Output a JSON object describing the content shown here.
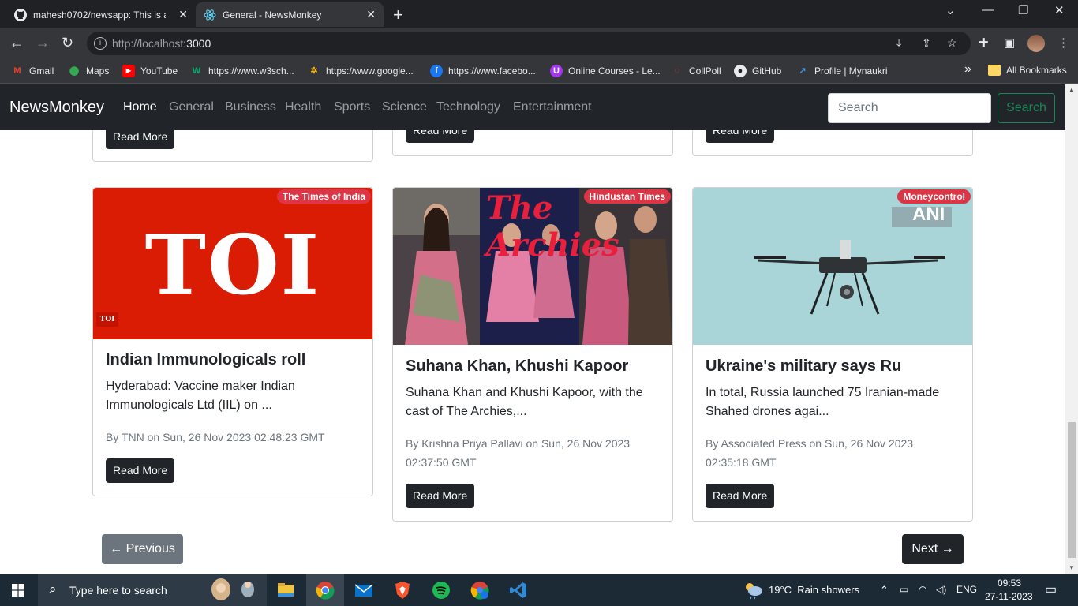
{
  "browser": {
    "tabs": [
      {
        "title": "mahesh0702/newsapp: This is a",
        "active": false
      },
      {
        "title": "General - NewsMonkey",
        "active": true
      }
    ],
    "url_host": "http://localhost",
    "url_port": ":3000",
    "bookmarks": [
      {
        "label": "Gmail",
        "icon": "gmail-icon"
      },
      {
        "label": "Maps",
        "icon": "maps-icon"
      },
      {
        "label": "YouTube",
        "icon": "youtube-icon"
      },
      {
        "label": "https://www.w3sch...",
        "icon": "w3schools-icon"
      },
      {
        "label": "https://www.google...",
        "icon": "google-photos-icon"
      },
      {
        "label": "https://www.facebo...",
        "icon": "facebook-icon"
      },
      {
        "label": "Online Courses - Le...",
        "icon": "udemy-icon"
      },
      {
        "label": "CollPoll",
        "icon": "collpoll-icon"
      },
      {
        "label": "GitHub",
        "icon": "github-icon"
      },
      {
        "label": "Profile | Mynaukri",
        "icon": "naukri-icon"
      }
    ],
    "bookmarks_overflow": "»",
    "all_bookmarks": "All Bookmarks"
  },
  "navbar": {
    "brand": "NewsMonkey",
    "links": [
      "Home",
      "General",
      "Business",
      "Health",
      "Sports",
      "Science",
      "Technology",
      "Entertainment"
    ],
    "active_link": "Home",
    "search_placeholder": "Search",
    "search_button": "Search"
  },
  "top_cards": {
    "read_more": "Read More"
  },
  "cards": [
    {
      "source": "The Times of India",
      "image_text": "TOI",
      "image_badge": "TOI",
      "title": "Indian Immunologicals roll",
      "description": "Hyderabad: Vaccine maker Indian Immunologicals Ltd (IIL) on ...",
      "meta": "By TNN on Sun, 26 Nov 2023 02:48:23 GMT",
      "button": "Read More"
    },
    {
      "source": "Hindustan Times",
      "image_text": "The Archies",
      "title": "Suhana Khan, Khushi Kapoor",
      "description": "Suhana Khan and Khushi Kapoor, with the cast of The Archies,...",
      "meta": "By Krishna Priya Pallavi on Sun, 26 Nov 2023 02:37:50 GMT",
      "button": "Read More"
    },
    {
      "source": "Moneycontrol",
      "image_text": "ANI",
      "title": "Ukraine's military says Ru",
      "description": "In total, Russia launched 75 Iranian-made Shahed drones agai...",
      "meta": "By Associated Press on Sun, 26 Nov 2023 02:35:18 GMT",
      "button": "Read More"
    }
  ],
  "pagination": {
    "previous": "← Previous",
    "next": "Next →"
  },
  "taskbar": {
    "search_placeholder": "Type here to search",
    "weather": "19°C  Rain showers",
    "language": "ENG",
    "time": "09:53",
    "date": "27-11-2023"
  }
}
